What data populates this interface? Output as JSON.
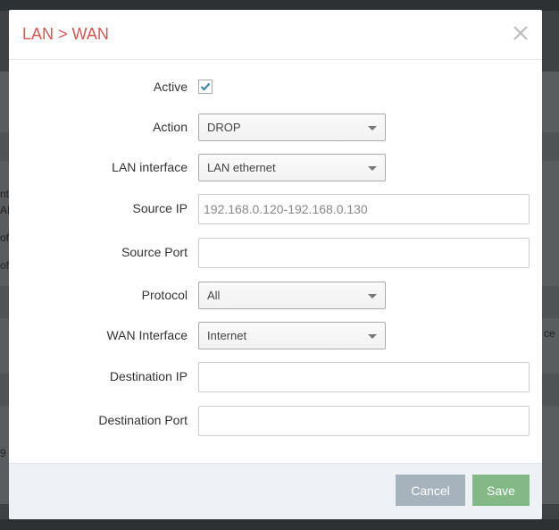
{
  "modal": {
    "title": "LAN > WAN",
    "close_glyph": "×"
  },
  "form": {
    "active": {
      "label": "Active",
      "checked": true
    },
    "action": {
      "label": "Action",
      "value": "DROP"
    },
    "lan_interface": {
      "label": "LAN interface",
      "value": "LAN ethernet"
    },
    "source_ip": {
      "label": "Source IP",
      "placeholder": "192.168.0.120-192.168.0.130",
      "value": ""
    },
    "source_port": {
      "label": "Source Port",
      "value": ""
    },
    "protocol": {
      "label": "Protocol",
      "value": "All"
    },
    "wan_interface": {
      "label": "WAN Interface",
      "value": "Internet"
    },
    "destination_ip": {
      "label": "Destination IP",
      "value": ""
    },
    "destination_port": {
      "label": "Destination Port",
      "value": ""
    }
  },
  "footer": {
    "cancel_label": "Cancel",
    "save_label": "Save"
  },
  "background": {
    "fragments": [
      "nt",
      "AI",
      "of",
      "of",
      "ce",
      "9"
    ]
  },
  "colors": {
    "title": "#d9534f",
    "checkmark": "#3a87ad",
    "cancel_button": "#a6b3bd",
    "save_button": "#82b986",
    "footer": "#eef1f5"
  },
  "icons": {
    "close": "close-icon",
    "check": "check-icon",
    "dropdown": "caret-down-icon"
  }
}
